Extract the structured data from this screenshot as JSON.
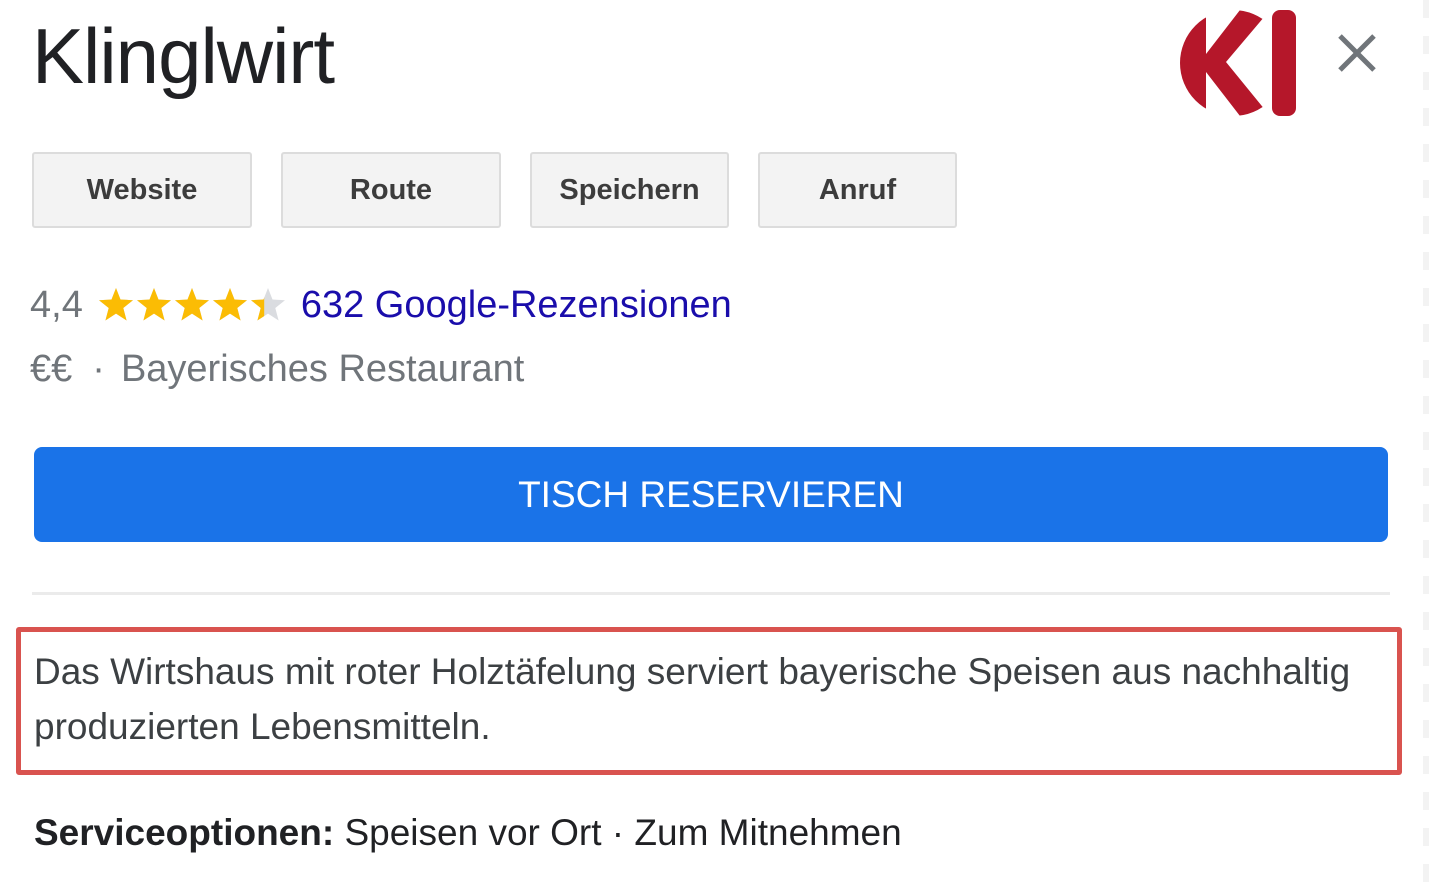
{
  "header": {
    "title": "Klinglwirt",
    "logo_text": "Kl",
    "logo_color": "#b5172a",
    "close_icon": "close-icon"
  },
  "actions": [
    {
      "label": "Website"
    },
    {
      "label": "Route"
    },
    {
      "label": "Speichern"
    },
    {
      "label": "Anruf"
    }
  ],
  "rating": {
    "value": "4,4",
    "stars_filled_fraction": 0.88,
    "star_color": "#fbbc04",
    "star_empty_color": "#dadce0",
    "reviews_link": "632 Google-Rezensionen"
  },
  "meta": {
    "price": "€€",
    "separator": "·",
    "category": "Bayerisches Restaurant"
  },
  "reserve_button": {
    "label": "TISCH RESERVIEREN",
    "color": "#1a73e8"
  },
  "description": {
    "text": "Das Wirtshaus mit roter Holztäfelung serviert bayerische Speisen aus nachhaltig produzierten Lebensmitteln.",
    "highlight_color": "#d9534f"
  },
  "service_options": {
    "label": "Serviceoptionen:",
    "value": " Speisen vor Ort · Zum Mitnehmen"
  }
}
